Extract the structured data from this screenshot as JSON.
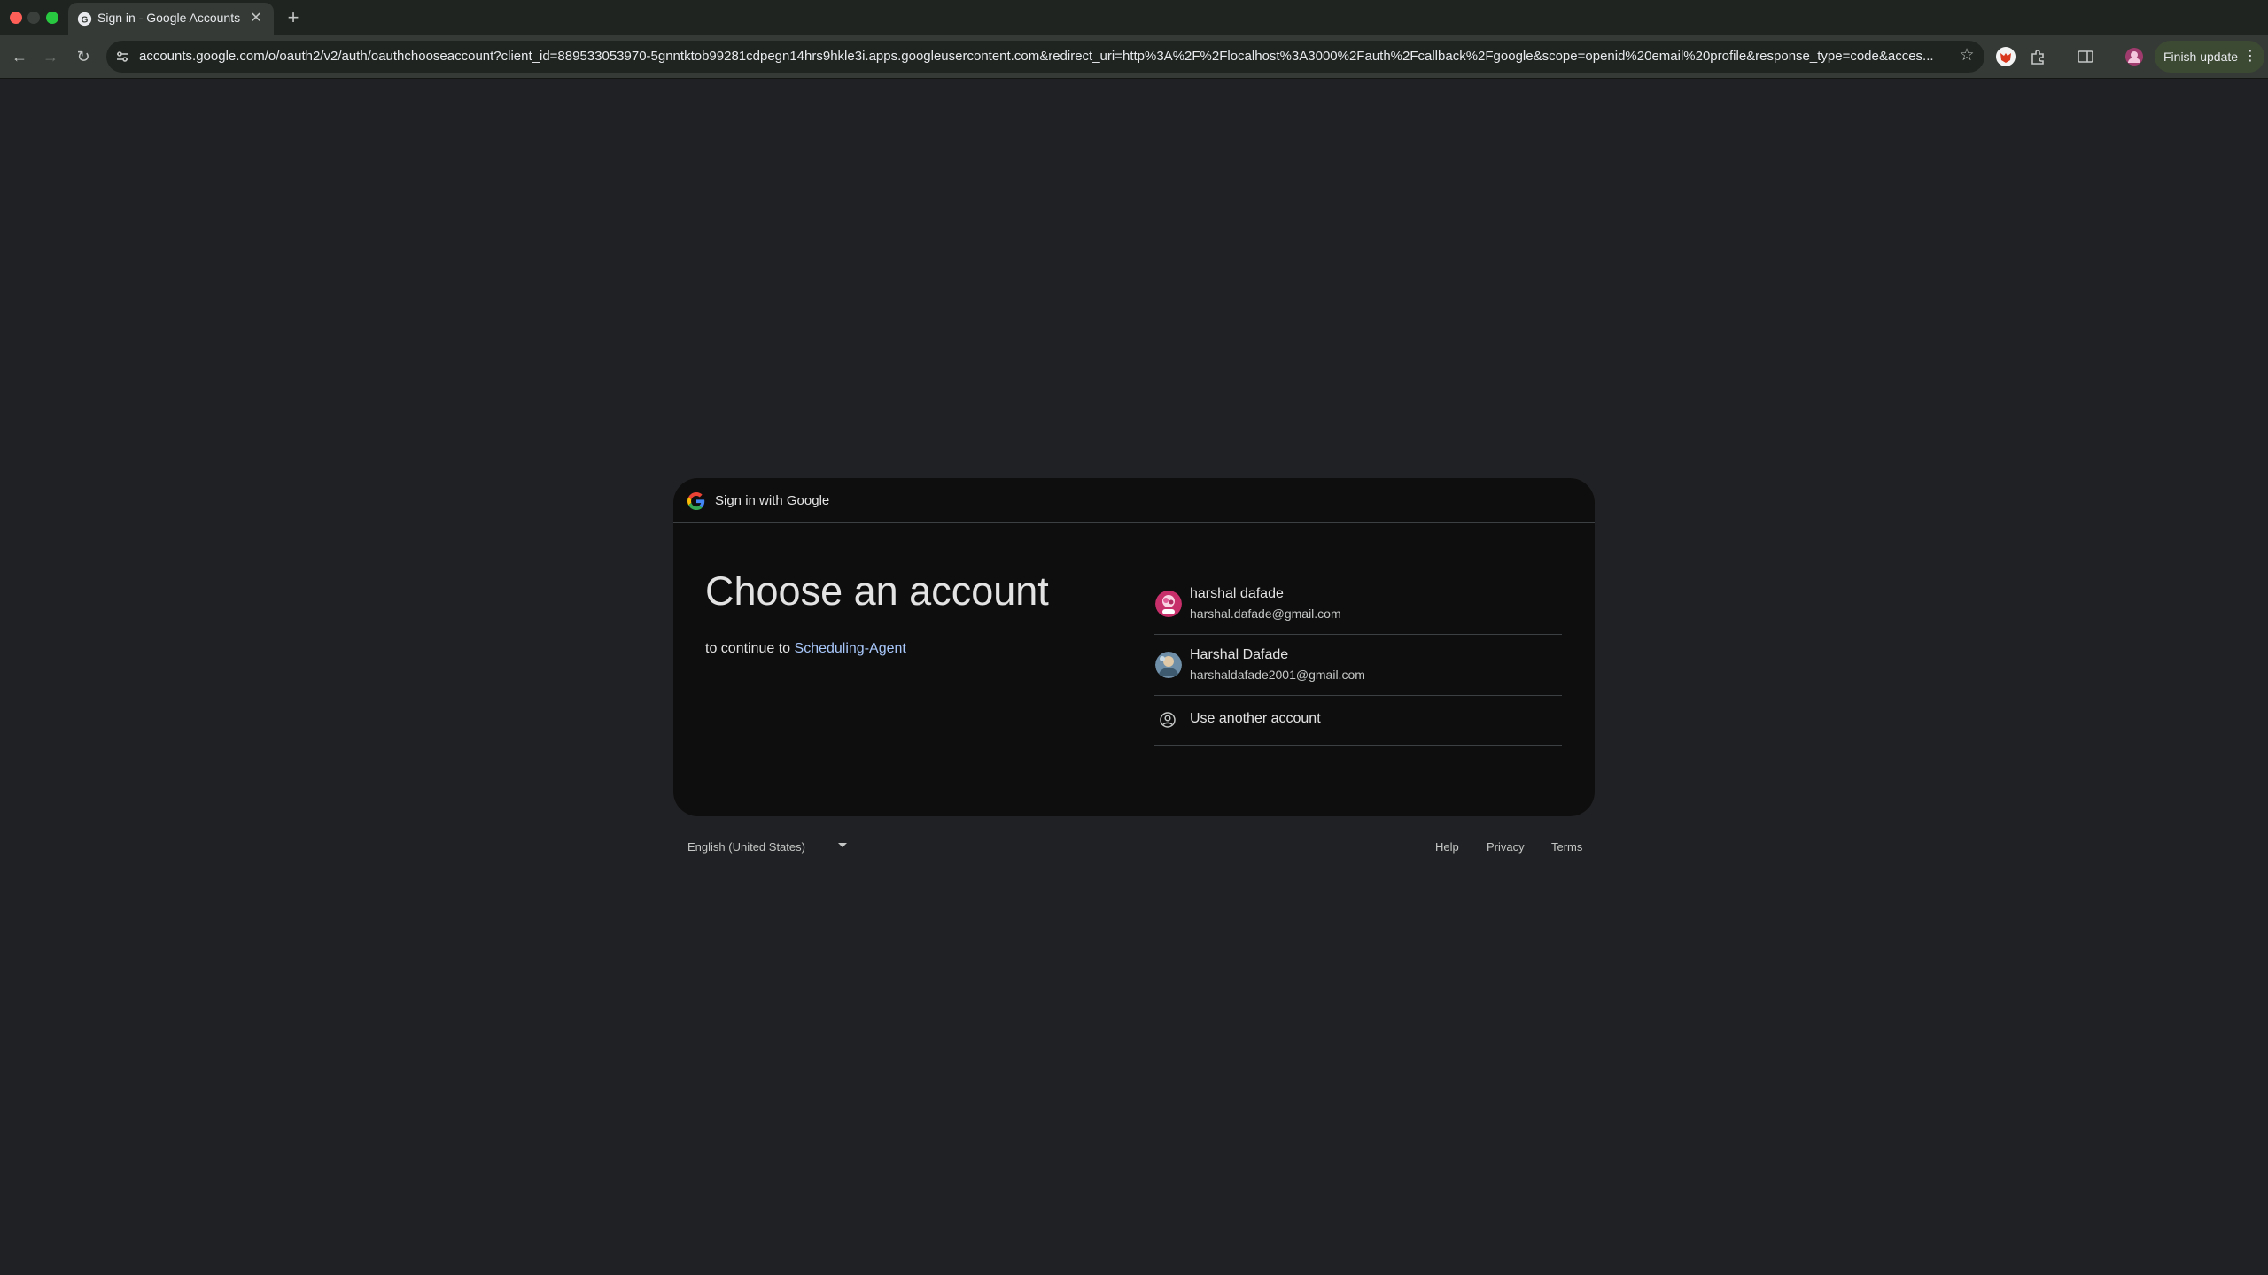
{
  "browser": {
    "tab_title": "Sign in - Google Accounts",
    "new_tab_icon": "plus-icon",
    "url": "accounts.google.com/o/oauth2/v2/auth/oauthchooseaccount?client_id=889533053970-5gnntktob99281cdpegn14hrs9hkle3i.apps.googleusercontent.com&redirect_uri=http%3A%2F%2Flocalhost%3A3000%2Fauth%2Fcallback%2Fgoogle&scope=openid%20email%20profile&response_type=code&acces...",
    "finish_update_label": "Finish update"
  },
  "card": {
    "header_text": "Sign in with Google",
    "heading": "Choose an account",
    "continue_prefix": "to continue to",
    "app_name": "Scheduling-Agent"
  },
  "accounts": [
    {
      "name": "harshal dafade",
      "email": "harshal.dafade@gmail.com"
    },
    {
      "name": "Harshal Dafade",
      "email": "harshaldafade2001@gmail.com"
    }
  ],
  "use_another_label": "Use another account",
  "footer": {
    "language": "English (United States)",
    "help": "Help",
    "privacy": "Privacy",
    "terms": "Terms"
  },
  "colors": {
    "background": "#202124",
    "card": "#0e0e0e",
    "link": "#a8c7fa",
    "finish_update": "#3d4a33"
  }
}
